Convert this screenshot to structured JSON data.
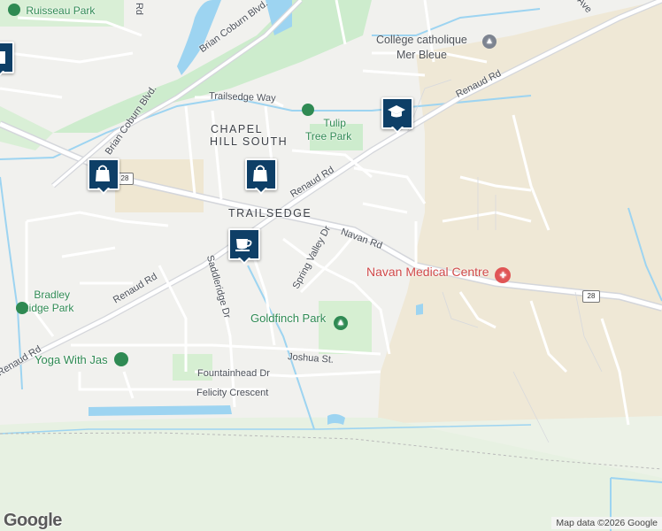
{
  "map": {
    "area_labels": [
      "CHAPEL",
      "HILL SOUTH",
      "TRAILSEDGE"
    ],
    "street_labels": {
      "joshua": "Joshua St.",
      "trailsedge_way": "Trailsedge Way",
      "brian_coburn_1": "Brian Coburn Blvd.",
      "brian_coburn_2": "Brian Coburn Blvd.",
      "renaud_upper_right": "Renaud Rd",
      "renaud_middle": "Renaud Rd",
      "renaud_left": "Renaud Rd",
      "renaud_far_left": "Renaud Rd",
      "navan": "Navan Rd",
      "spring_valley": "Spring Valley Dr",
      "saddleridge": "Saddleridge Dr",
      "fountainhead": "Fountainhead Dr",
      "felicity": "Felicity Crescent",
      "dr_top": "Rd",
      "ave_top": "Ave"
    },
    "parks": {
      "ruisseau": "Ruisseau Park",
      "tulip_1": "Tulip",
      "tulip_2": "Tree Park",
      "bradley_1": "Bradley",
      "bradley_2": "Ridge Park",
      "goldfinch": "Goldfinch Park"
    },
    "pois": {
      "college_1": "Collège catholique",
      "college_2": "Mer Bleue",
      "navan_medical": "Navan Medical Centre",
      "yoga": "Yoga With Jas"
    },
    "route_shields": [
      "28",
      "28"
    ],
    "markers": [
      {
        "icon": "school-icon"
      },
      {
        "icon": "shopping-bag-icon"
      },
      {
        "icon": "shopping-bag-icon"
      },
      {
        "icon": "coffee-icon"
      },
      {
        "icon": "bank-icon"
      }
    ],
    "google_logo": "Google",
    "attribution": "Map data ©2026 Google",
    "colors": {
      "marker": "#0e3f67",
      "park": "#cdeccd",
      "water": "#9dd4f1",
      "medical": "#e05555",
      "park_label": "#2f8a53"
    }
  }
}
